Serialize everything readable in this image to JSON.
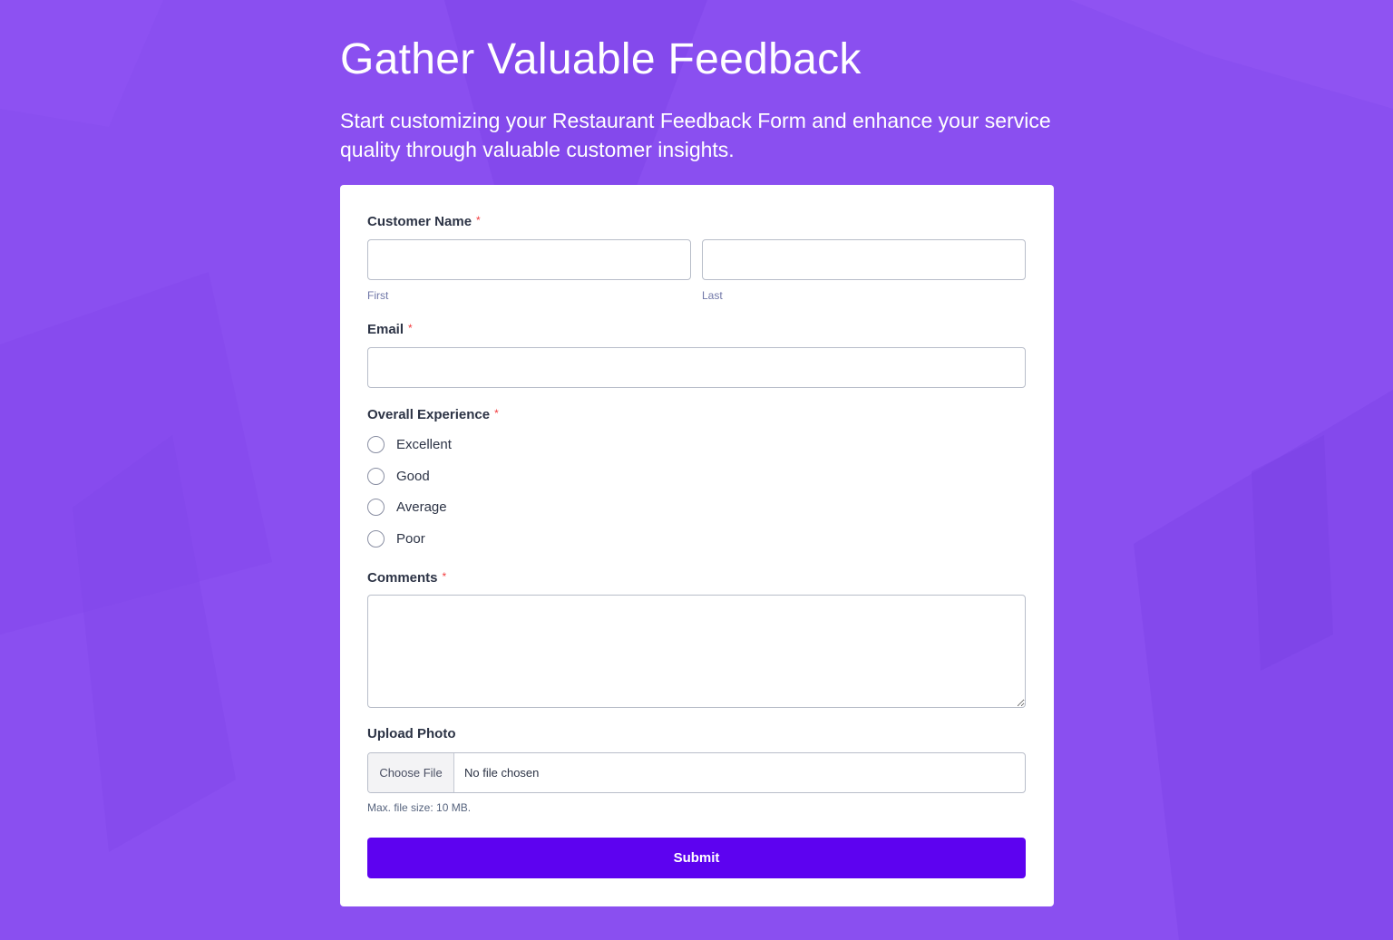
{
  "header": {
    "title": "Gather Valuable Feedback",
    "subtitle": "Start customizing your Restaurant Feedback Form and enhance your service quality through valuable customer insights."
  },
  "form": {
    "customer_name": {
      "label": "Customer Name",
      "required_mark": "*",
      "first_value": "",
      "last_value": "",
      "first_sublabel": "First",
      "last_sublabel": "Last"
    },
    "email": {
      "label": "Email",
      "required_mark": "*",
      "value": ""
    },
    "overall_experience": {
      "label": "Overall Experience",
      "required_mark": "*",
      "options": [
        "Excellent",
        "Good",
        "Average",
        "Poor"
      ],
      "selected": null
    },
    "comments": {
      "label": "Comments",
      "required_mark": "*",
      "value": ""
    },
    "upload_photo": {
      "label": "Upload Photo",
      "button_label": "Choose File",
      "status": "No file chosen",
      "hint": "Max. file size: 10 MB."
    },
    "submit_label": "Submit"
  },
  "colors": {
    "background": "#8a4ff0",
    "card": "#ffffff",
    "submit": "#5d02f0",
    "required": "#f23a3c"
  }
}
